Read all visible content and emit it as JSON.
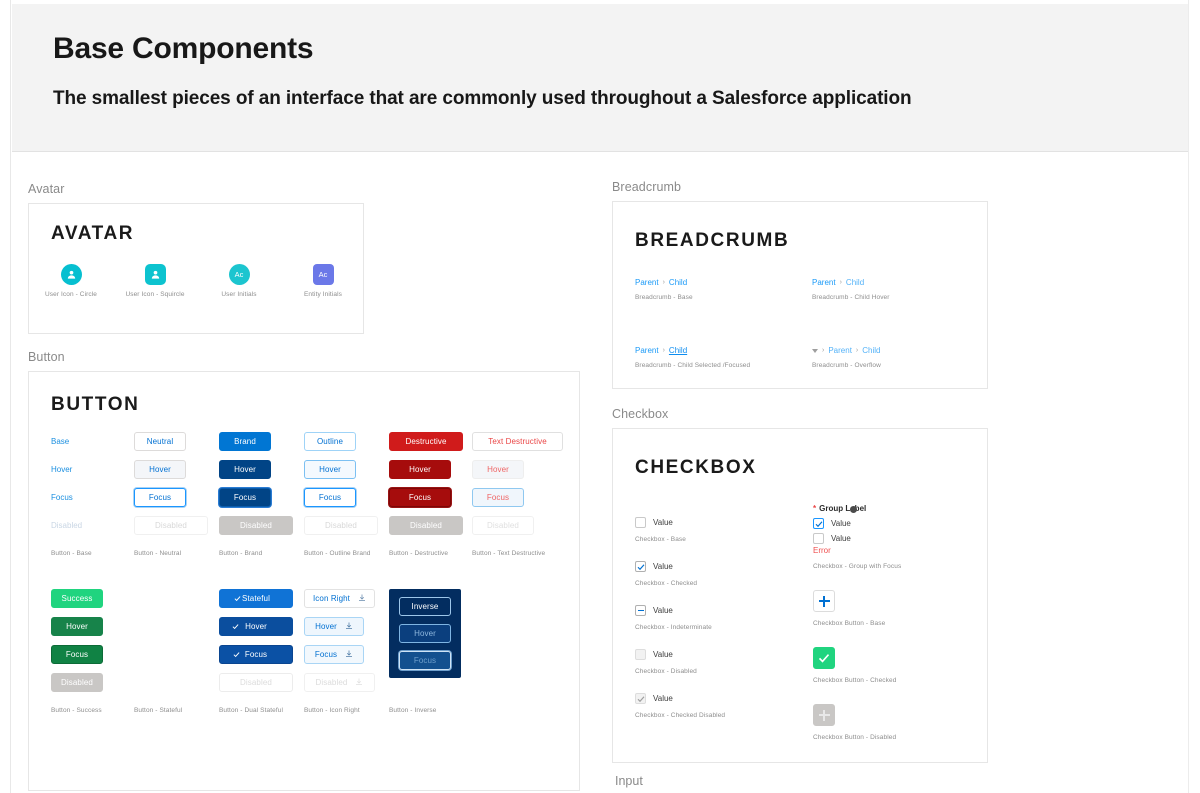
{
  "header": {
    "title": "Base Components",
    "subtitle": "The smallest pieces of an interface that are commonly used throughout a Salesforce application"
  },
  "sections": {
    "avatar_label": "Avatar",
    "button_label": "Button",
    "breadcrumb_label": "Breadcrumb",
    "checkbox_label": "Checkbox",
    "input_label": "Input"
  },
  "avatar": {
    "title": "AVATAR",
    "items": [
      {
        "caption": "User Icon - Circle",
        "icon": "user-icon",
        "shape": "circle",
        "color": "#06bfd0",
        "text": ""
      },
      {
        "caption": "User Icon - Squircle",
        "icon": "user-icon",
        "shape": "squircle",
        "color": "#0dc3cf",
        "text": ""
      },
      {
        "caption": "User Initials",
        "icon": "initials",
        "shape": "circle",
        "color": "#1cc5cf",
        "text": "Ac"
      },
      {
        "caption": "Entity Initials",
        "icon": "initials",
        "shape": "squircle",
        "color": "#6b78e8",
        "text": "Ac"
      }
    ]
  },
  "button": {
    "title": "BUTTON",
    "states": [
      "Base",
      "Hover",
      "Focus",
      "Disabled"
    ],
    "row1_captions": [
      "Button - Base",
      "Button - Neutral",
      "Button - Brand",
      "Button - Outline Brand",
      "Button - Destructive",
      "Button - Text Destructive"
    ],
    "row2_captions": [
      "Button - Success",
      "Button - Stateful",
      "Button - Dual Stateful",
      "Button - Icon Right",
      "Button - Inverse"
    ],
    "neutral": [
      "Neutral",
      "Hover",
      "Focus",
      "Disabled"
    ],
    "brand": [
      "Brand",
      "Hover",
      "Focus",
      "Disabled"
    ],
    "outline": [
      "Outline",
      "Hover",
      "Focus",
      "Disabled"
    ],
    "destructive": [
      "Destructive",
      "Hover",
      "Focus",
      "Disabled"
    ],
    "text_destructive": [
      "Text Destructive",
      "Hover",
      "Focus",
      "Disabled"
    ],
    "success": [
      "Success",
      "Hover",
      "Focus",
      "Disabled"
    ],
    "dual_stateful": [
      "Stateful",
      "Hover",
      "Focus",
      "Disabled"
    ],
    "icon_right": [
      "Icon Right",
      "Hover",
      "Focus",
      "Disabled"
    ],
    "inverse": [
      "Inverse",
      "Hover",
      "Focus"
    ],
    "icon_right_glyph": "download-icon",
    "dual_stateful_glyph": "check-icon"
  },
  "breadcrumb": {
    "title": "BREADCRUMB",
    "items": [
      {
        "parent": "Parent",
        "child": "Child",
        "separator": "›",
        "caption": "Breadcrumb - Base",
        "variant": "base"
      },
      {
        "parent": "Parent",
        "child": "Child",
        "separator": "›",
        "caption": "Breadcrumb - Child Hover",
        "variant": "hover"
      },
      {
        "parent": "Parent",
        "child": "Child",
        "separator": "›",
        "caption": "Breadcrumb - Child Selected /Focused",
        "variant": "selected"
      },
      {
        "parent": "Parent",
        "child": "Child",
        "separator": "›",
        "caption": "Breadcrumb - Overflow",
        "variant": "overflow"
      }
    ]
  },
  "checkbox": {
    "title": "CHECKBOX",
    "left": [
      {
        "label": "Value",
        "caption": "Checkbox - Base",
        "state": "base"
      },
      {
        "label": "Value",
        "caption": "Checkbox - Checked",
        "state": "checked"
      },
      {
        "label": "Value",
        "caption": "Checkbox - Indeterminate",
        "state": "indeterminate"
      },
      {
        "label": "Value",
        "caption": "Checkbox - Disabled",
        "state": "disabled"
      },
      {
        "label": "Value",
        "caption": "Checkbox - Checked Disabled",
        "state": "checked-disabled"
      }
    ],
    "group": {
      "group_label": "Group Label",
      "required_mark": "*",
      "rows": [
        {
          "label": "Value",
          "state": "checked-focus"
        },
        {
          "label": "Value",
          "state": "base"
        }
      ],
      "error": "Error",
      "caption": "Checkbox -  Group with Focus"
    },
    "buttons": [
      {
        "glyph": "plus-icon",
        "caption": "Checkbox Button -  Base",
        "state": "base"
      },
      {
        "glyph": "check-icon",
        "caption": "Checkbox Button -  Checked",
        "state": "checked"
      },
      {
        "glyph": "plus-icon",
        "caption": "Checkbox Button -  Disabled",
        "state": "disabled"
      }
    ]
  },
  "colors": {
    "brand_blue": "#0176d3",
    "link_blue": "#1b9af7",
    "destructive_red": "#d01b1b",
    "success_green": "#20d47f",
    "inverse_navy": "#032d60",
    "disabled_gray": "#c9c7c5",
    "avatar_teal": "#06bfd0",
    "entity_purple": "#6b78e8",
    "header_bg": "#f3f3f3"
  }
}
